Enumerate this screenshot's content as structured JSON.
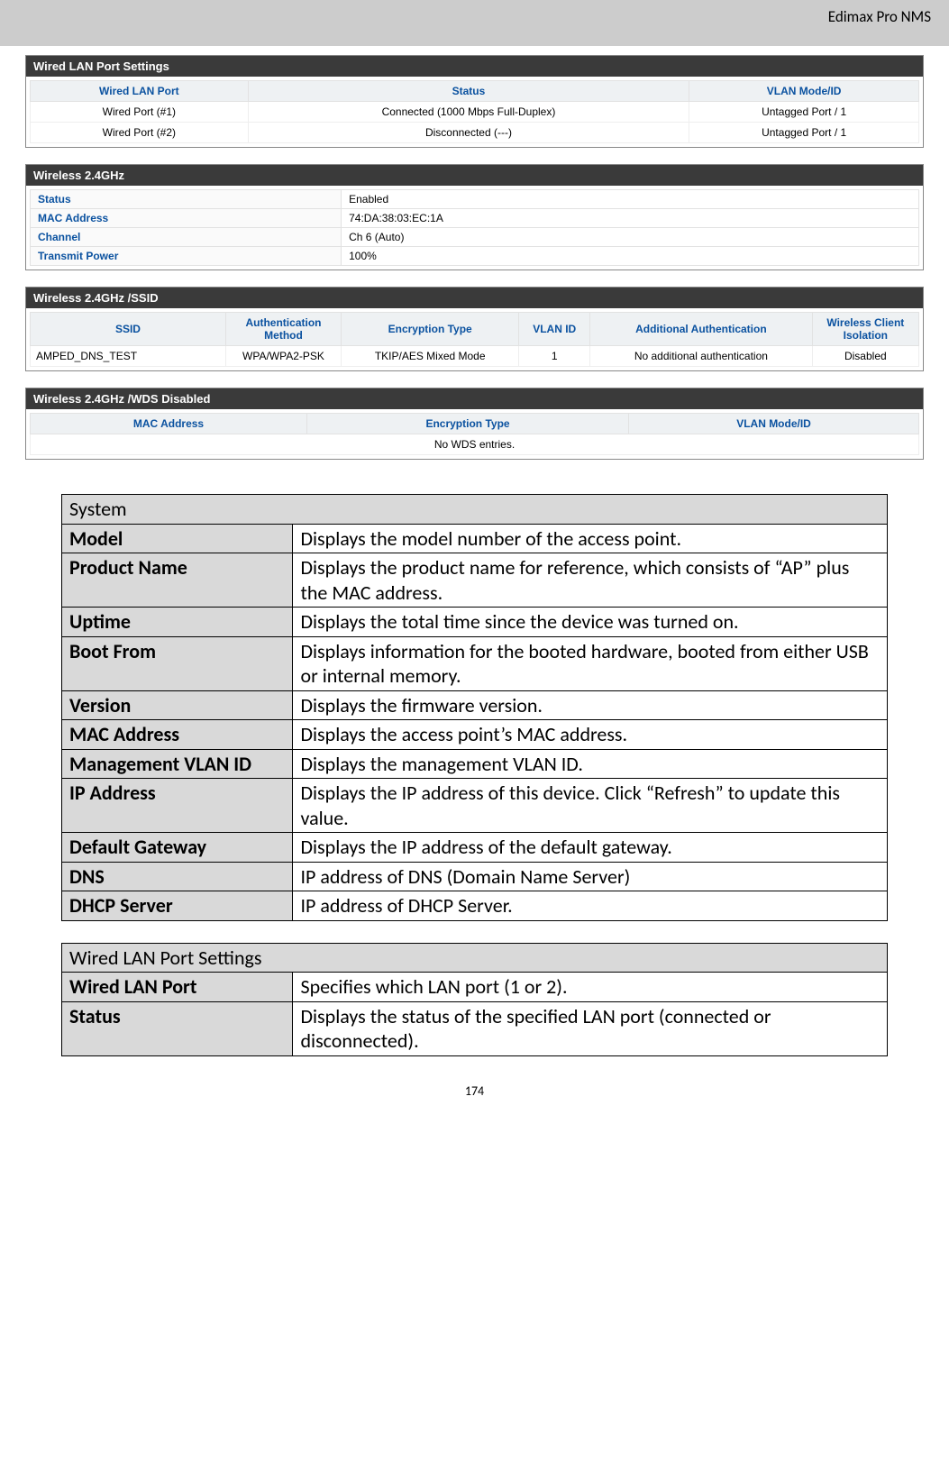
{
  "header": {
    "title": "Edimax Pro NMS"
  },
  "page_number": "174",
  "wired_lan_panel": {
    "title": "Wired LAN Port Settings",
    "headers": {
      "col1": "Wired LAN Port",
      "col2": "Status",
      "col3": "VLAN Mode/ID"
    },
    "rows": [
      {
        "port": "Wired Port (#1)",
        "status": "Connected (1000 Mbps Full-Duplex)",
        "vlan": "Untagged Port  /   1"
      },
      {
        "port": "Wired Port (#2)",
        "status": "Disconnected (---)",
        "vlan": "Untagged Port  /   1"
      }
    ]
  },
  "wireless_24_panel": {
    "title": "Wireless 2.4GHz",
    "rows": {
      "status_label": "Status",
      "status_value": "Enabled",
      "mac_label": "MAC Address",
      "mac_value": "74:DA:38:03:EC:1A",
      "channel_label": "Channel",
      "channel_value": "Ch 6 (Auto)",
      "txpower_label": "Transmit Power",
      "txpower_value": "100%"
    }
  },
  "wireless_ssid_panel": {
    "title": "Wireless 2.4GHz /SSID",
    "headers": {
      "ssid": "SSID",
      "auth": "Authentication Method",
      "enc": "Encryption Type",
      "vlan": "VLAN ID",
      "addauth": "Additional Authentication",
      "iso": "Wireless Client Isolation"
    },
    "row": {
      "ssid": "AMPED_DNS_TEST",
      "auth": "WPA/WPA2-PSK",
      "enc": "TKIP/AES Mixed Mode",
      "vlan": "1",
      "addauth": "No additional authentication",
      "iso": "Disabled"
    }
  },
  "wds_panel": {
    "title": "Wireless 2.4GHz /WDS Disabled",
    "headers": {
      "mac": "MAC Address",
      "enc": "Encryption Type",
      "vlan": "VLAN Mode/ID"
    },
    "empty": "No WDS entries."
  },
  "system_table": {
    "section": "System",
    "rows": [
      {
        "label": "Model",
        "desc": "Displays the model number of the access point."
      },
      {
        "label": "Product Name",
        "desc": "Displays the product name for reference, which consists of “AP” plus the MAC address."
      },
      {
        "label": "Uptime",
        "desc": "Displays the total time since the device was turned on."
      },
      {
        "label": "Boot From",
        "desc": "Displays information for the booted hardware, booted from either USB or internal memory."
      },
      {
        "label": "Version",
        "desc": "Displays the firmware version."
      },
      {
        "label": "MAC Address",
        "desc": "Displays the access point’s MAC address."
      },
      {
        "label": "Management VLAN ID",
        "desc": "Displays the management VLAN ID."
      },
      {
        "label": "IP Address",
        "desc": "Displays the IP address of this device. Click “Refresh” to update this value."
      },
      {
        "label": "Default Gateway",
        "desc": "Displays the IP address of the default gateway."
      },
      {
        "label": "DNS",
        "desc": "IP address of DNS (Domain Name Server)"
      },
      {
        "label": "DHCP Server",
        "desc": "IP address of DHCP Server."
      }
    ]
  },
  "wired_lan_table": {
    "section": "Wired LAN Port Settings",
    "rows": [
      {
        "label": "Wired LAN Port",
        "desc": "Specifies which LAN port (1 or 2)."
      },
      {
        "label": "Status",
        "desc": "Displays the status of the specified LAN port (connected or disconnected)."
      }
    ]
  }
}
